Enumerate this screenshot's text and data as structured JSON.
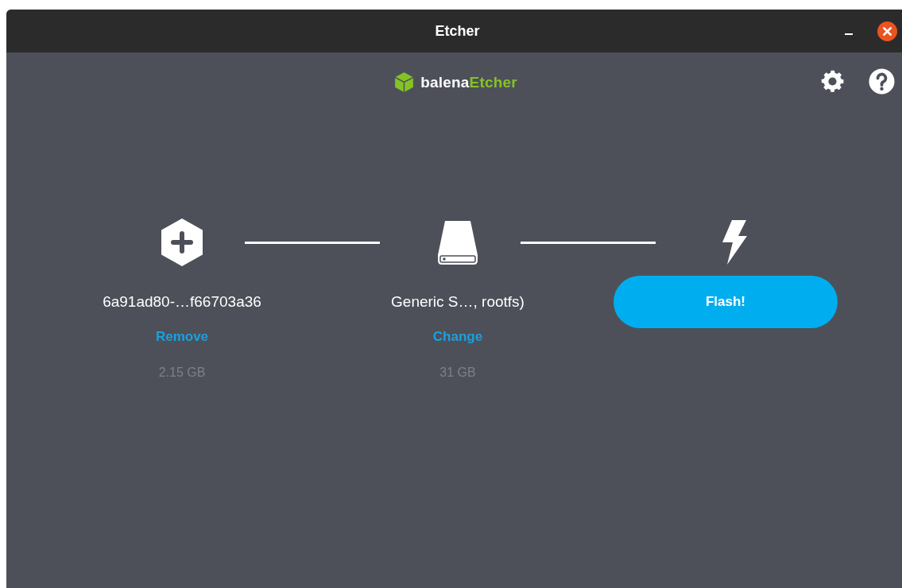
{
  "window": {
    "title": "Etcher"
  },
  "header": {
    "logo": {
      "brand": "balena",
      "product": "Etcher"
    }
  },
  "steps": [
    {
      "kind": "source",
      "name": "6a91ad80-…f66703a36",
      "action": "Remove",
      "size": "2.15 GB"
    },
    {
      "kind": "target",
      "name": "Generic S…, rootfs)",
      "action": "Change",
      "size": "31 GB"
    },
    {
      "kind": "flash",
      "button": "Flash!"
    }
  ]
}
